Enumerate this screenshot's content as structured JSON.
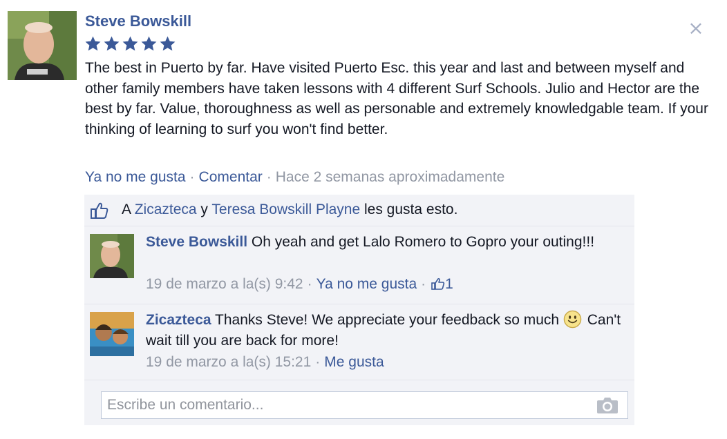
{
  "review": {
    "author": "Steve Bowskill",
    "rating": 5,
    "text": "The best in Puerto by far. Have visited Puerto Esc. this year and last and between myself and other family members have taken lessons with 4 different Surf Schools. Julio and Hector are the best by far. Value, thoroughness as well as personable and extremely knowledgable team. If your thinking of learning to surf you won't find better.",
    "close_label": "×",
    "actions": {
      "unlike": "Ya no me gusta",
      "comment": "Comentar",
      "separator": "·",
      "time": "Hace 2 semanas aproximadamente"
    }
  },
  "likes": {
    "prefix": "A",
    "user1": "Zicazteca",
    "conj": "y",
    "user2": "Teresa Bowskill Playne",
    "suffix": "les gusta esto."
  },
  "comments": [
    {
      "author": "Steve Bowskill",
      "text": "Oh yeah and get Lalo Romero to Gopro your outing!!!",
      "time": "19 de marzo a la(s) 9:42",
      "action": "Ya no me gusta",
      "like_count": "1"
    },
    {
      "author": "Zicazteca",
      "text_before": "Thanks Steve! We appreciate your feedback so much",
      "text_after": "Can't wait till you are back for more!",
      "time": "19 de marzo a la(s) 15:21",
      "action": "Me gusta"
    }
  ],
  "composer": {
    "placeholder": "Escribe un comentario...",
    "camera_icon": "camera-icon"
  },
  "colors": {
    "link": "#3b5998",
    "star": "#3b5998",
    "meta": "#9197a3",
    "panel": "#f2f3f7"
  }
}
